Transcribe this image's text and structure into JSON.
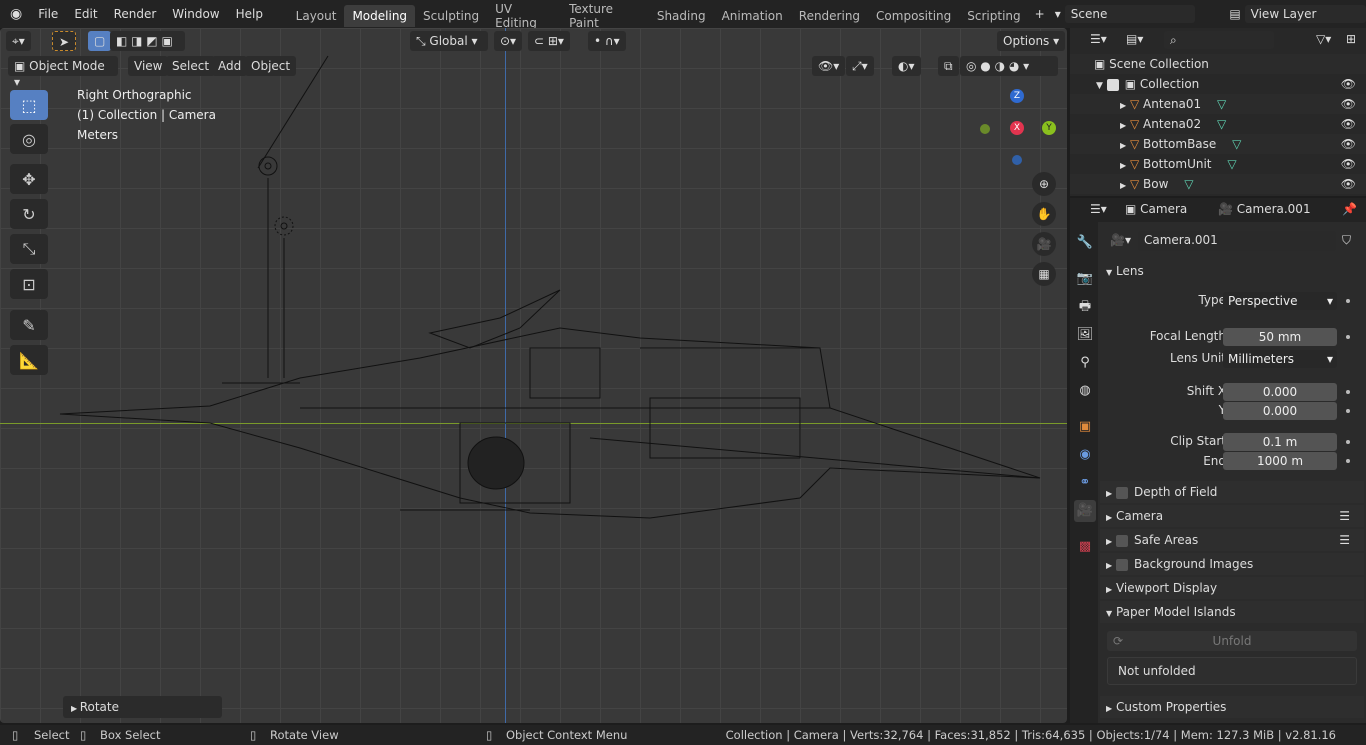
{
  "topbar": {
    "menus": [
      "File",
      "Edit",
      "Render",
      "Window",
      "Help"
    ],
    "workspaces": [
      "Layout",
      "Modeling",
      "Sculpting",
      "UV Editing",
      "Texture Paint",
      "Shading",
      "Animation",
      "Rendering",
      "Compositing",
      "Scripting"
    ],
    "active_workspace": "Modeling",
    "scene": "Scene",
    "view_layer": "View Layer"
  },
  "viewport": {
    "mode": "Object Mode",
    "menus": [
      "View",
      "Select",
      "Add",
      "Object"
    ],
    "orientation": "Global",
    "options": "Options",
    "overlay_lines": [
      "Right Orthographic",
      "(1) Collection | Camera",
      "Meters"
    ],
    "gizmo": {
      "z": "Z",
      "x": "X",
      "y": "Y"
    },
    "last_op": "Rotate"
  },
  "outliner": {
    "root": "Scene Collection",
    "collection": "Collection",
    "items": [
      "Antena01",
      "Antena02",
      "BottomBase",
      "BottomUnit",
      "Bow"
    ]
  },
  "properties": {
    "breadcrumb_object": "Camera",
    "breadcrumb_data": "Camera.001",
    "datablock": "Camera.001",
    "lens_header": "Lens",
    "type_label": "Type",
    "type_value": "Perspective",
    "focal_label": "Focal Length",
    "focal_value": "50 mm",
    "unit_label": "Lens Unit",
    "unit_value": "Millimeters",
    "shiftx_label": "Shift X",
    "shiftx_value": "0.000",
    "shifty_label": "Y",
    "shifty_value": "0.000",
    "clipstart_label": "Clip Start",
    "clipstart_value": "0.1 m",
    "clipend_label": "End",
    "clipend_value": "1000 m",
    "panels": [
      "Depth of Field",
      "Camera",
      "Safe Areas",
      "Background Images",
      "Viewport Display",
      "Paper Model Islands"
    ],
    "unfold_button": "Unfold",
    "unfold_status": "Not unfolded",
    "custom_props": "Custom Properties"
  },
  "status": {
    "select": "Select",
    "box_select": "Box Select",
    "rotate_view": "Rotate View",
    "context_menu": "Object Context Menu",
    "info": "Collection | Camera | Verts:32,764 | Faces:31,852 | Tris:64,635 | Objects:1/74 | Mem: 127.3 MiB | v2.81.16"
  }
}
